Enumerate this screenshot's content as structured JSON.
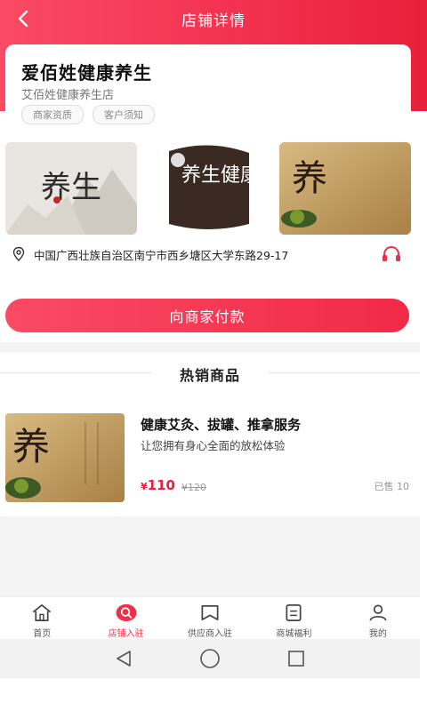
{
  "nav": {
    "title": "店铺详情",
    "back_icon": "back-arrow-icon"
  },
  "colors": {
    "brand": "#f2304e",
    "price": "#e8203a",
    "tab_active": "#f03048"
  },
  "shop": {
    "name": "爱佰姓健康养生",
    "subtitle": "艾佰姓健康养生店",
    "tags": [
      "商家资质",
      "客户须知"
    ]
  },
  "gallery": {
    "images": [
      {
        "label": "养生",
        "alt_icon": "calligraphy-landscape-image"
      },
      {
        "label": "养生健康",
        "alt_icon": "calligraphy-logo-image"
      },
      {
        "label": "养",
        "alt_icon": "ginseng-tea-image"
      }
    ]
  },
  "address": {
    "text": "中国广西壮族自治区南宁市西乡塘区大学东路29-17",
    "pin_icon": "location-pin-icon",
    "phone_icon": "headset-icon"
  },
  "pay_button": {
    "label": "向商家付款"
  },
  "hot_section": {
    "title": "热销商品"
  },
  "product": {
    "name": "健康艾灸、拔罐、推拿服务",
    "description": "让您拥有身心全面的放松体验",
    "price_symbol": "¥",
    "price": "110",
    "old_price": "¥120",
    "sold": "已售 10"
  },
  "tabbar": {
    "items": [
      {
        "label": "首页",
        "icon": "home-icon"
      },
      {
        "label": "店铺入驻",
        "icon": "search-store-icon",
        "active": true
      },
      {
        "label": "供应商入驻",
        "icon": "supplier-icon"
      },
      {
        "label": "商城福利",
        "icon": "document-icon"
      },
      {
        "label": "我的",
        "icon": "user-icon"
      }
    ]
  },
  "system_nav": {
    "icons": [
      "back-triangle-icon",
      "home-circle-icon",
      "recents-square-icon"
    ]
  }
}
